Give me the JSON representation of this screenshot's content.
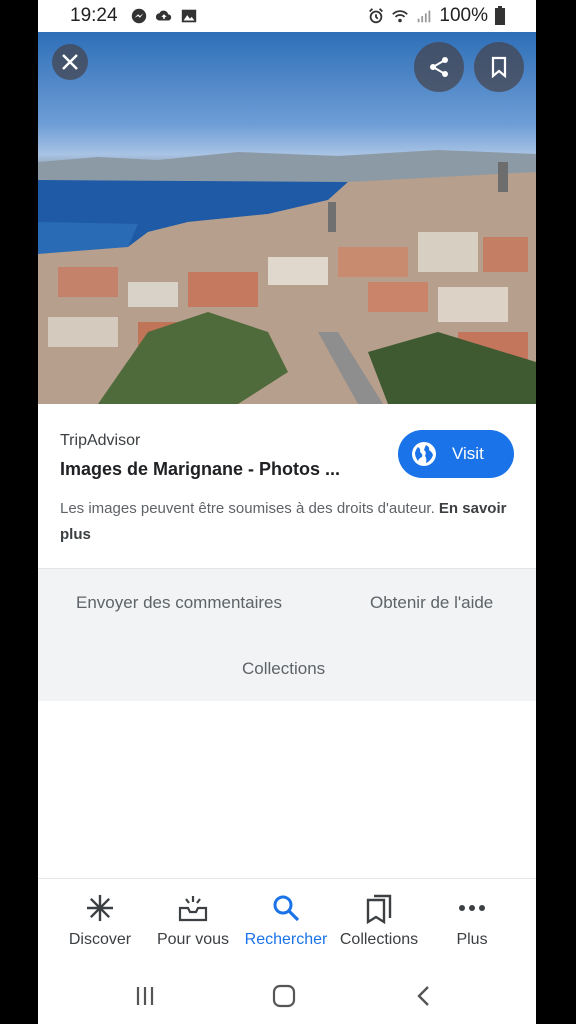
{
  "status_bar": {
    "time": "19:24",
    "battery": "100%",
    "left_icons": [
      "messenger-icon",
      "cloud-upload-icon",
      "image-icon"
    ],
    "right_icons": [
      "alarm-icon",
      "wifi-icon",
      "signal-icon",
      "battery-icon"
    ]
  },
  "viewer": {
    "close_icon": "close-icon",
    "share_icon": "share-icon",
    "bookmark_icon": "bookmark-icon",
    "image_subject": "aerial city view over bay"
  },
  "result": {
    "source": "TripAdvisor",
    "title": "Images de Marignane - Photos ...",
    "visit_label": "Visit",
    "notice_text": "Les images peuvent être soumises à des droits d'auteur. ",
    "learn_more": "En savoir plus"
  },
  "footer_links": {
    "feedback": "Envoyer des commentaires",
    "help": "Obtenir de l'aide",
    "collections": "Collections"
  },
  "bottom_nav": {
    "items": [
      {
        "label": "Discover",
        "icon": "asterisk-icon"
      },
      {
        "label": "Pour vous",
        "icon": "inbox-sparkle-icon"
      },
      {
        "label": "Rechercher",
        "icon": "search-icon"
      },
      {
        "label": "Collections",
        "icon": "collections-icon"
      },
      {
        "label": "Plus",
        "icon": "more-dots-icon"
      }
    ],
    "active": "Rechercher"
  },
  "colors": {
    "accent": "#1a73e8",
    "panel": "#f1f3f4",
    "text_secondary": "#5f6368"
  }
}
